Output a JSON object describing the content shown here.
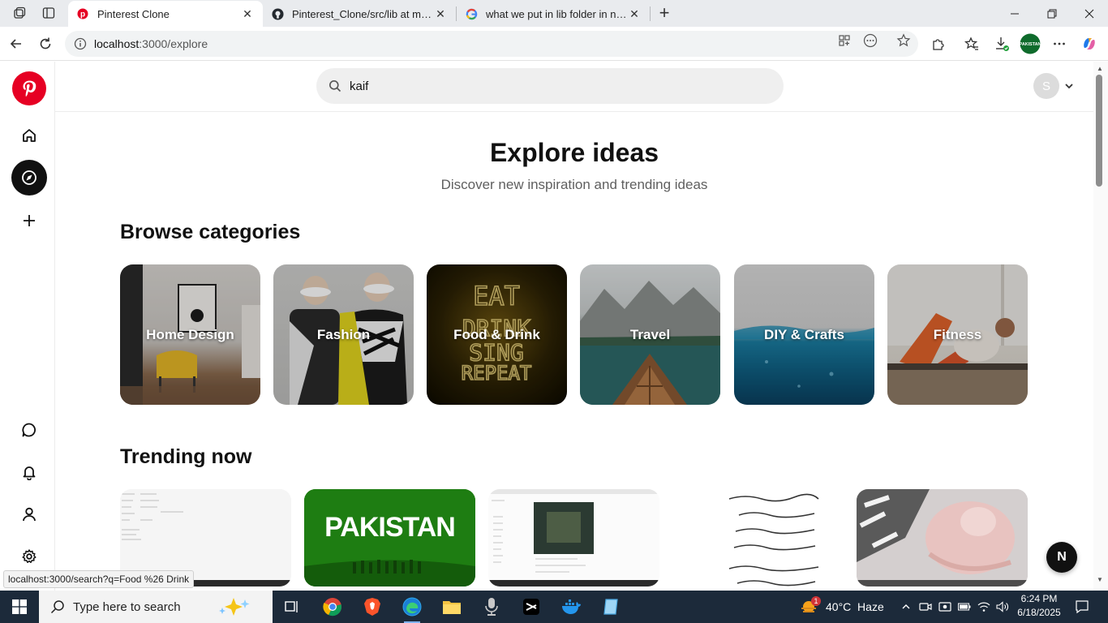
{
  "browser": {
    "tabs": [
      {
        "title": "Pinterest Clone",
        "active": true
      },
      {
        "title": "Pinterest_Clone/src/lib at main · M",
        "active": false
      },
      {
        "title": "what we put in lib folder in nextjs",
        "active": false
      }
    ],
    "address": {
      "host": "localhost",
      "path": ":3000/explore"
    },
    "status_url": "localhost:3000/search?q=Food %26 Drink"
  },
  "header": {
    "search_value": "kaif",
    "avatar_initial": "S"
  },
  "main": {
    "title": "Explore ideas",
    "subtitle": "Discover new inspiration and trending ideas",
    "browse_title": "Browse categories",
    "trending_title": "Trending now",
    "categories": [
      {
        "label": "Home Design"
      },
      {
        "label": "Fashion"
      },
      {
        "label": "Food & Drink"
      },
      {
        "label": "Travel"
      },
      {
        "label": "DIY & Crafts"
      },
      {
        "label": "Fitness"
      }
    ],
    "trending_text": {
      "pakistan": "PAKISTAN"
    }
  },
  "fab_label": "N",
  "taskbar": {
    "search_placeholder": "Type here to search",
    "weather": "40°C  Haze",
    "weather_badge": "1",
    "time": "6:24 PM",
    "date": "6/18/2025"
  },
  "colors": {
    "brand": "#e60023",
    "active_nav": "#111111",
    "taskbar": "#1c2a3a"
  }
}
